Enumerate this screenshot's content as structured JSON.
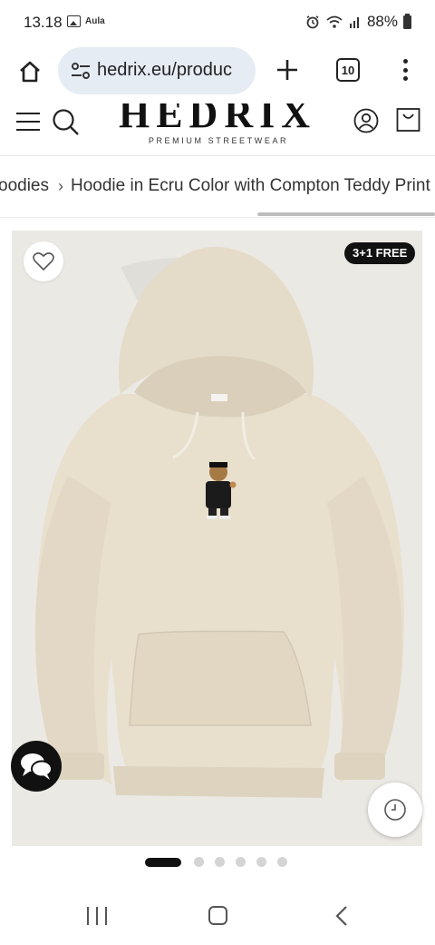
{
  "status_bar": {
    "time": "13.18",
    "app_label": "Aula",
    "battery": "88%"
  },
  "browser": {
    "url": "hedrix.eu/produc",
    "tab_count": "10"
  },
  "site_header": {
    "logo": "HEDRIX",
    "tagline": "PREMIUM STREETWEAR"
  },
  "breadcrumb": {
    "items": [
      "oodies",
      "Hoodie in Ecru Color with Compton Teddy Print"
    ]
  },
  "product": {
    "badge": "3+1 FREE",
    "hoodie_color": "#e8dfcd",
    "gallery_dots": 6,
    "active_dot": 0
  },
  "colors": {
    "accent": "#111111",
    "url_bar": "#e6ecf3",
    "background": "#ebe9e4"
  }
}
